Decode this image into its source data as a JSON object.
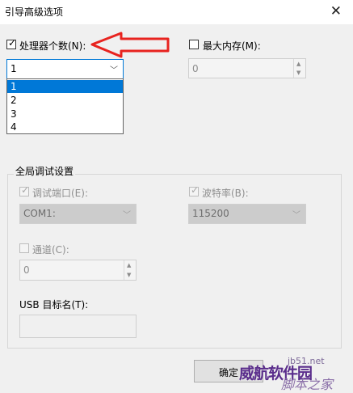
{
  "window": {
    "title": "引导高级选项"
  },
  "processors": {
    "label": "处理器个数(N):",
    "checked": true,
    "selected": "1",
    "options": [
      "1",
      "2",
      "3",
      "4"
    ]
  },
  "max_memory": {
    "label": "最大内存(M):",
    "checked": false,
    "value": "0"
  },
  "debug_group": {
    "title": "全局调试设置",
    "debug_port": {
      "label": "调试端口(E):",
      "value": "COM1:"
    },
    "baud_rate": {
      "label": "波特率(B):",
      "value": "115200"
    },
    "channel": {
      "label": "通道(C):",
      "value": "0"
    },
    "usb_target": {
      "label": "USB 目标名(T):",
      "value": ""
    }
  },
  "buttons": {
    "ok": "确定"
  },
  "watermark": {
    "line1": "威航软件园",
    "line2": "脚本之家",
    "line3": "jb51.net"
  },
  "colors": {
    "selection": "#0078d7",
    "annotation_arrow": "#e8231f",
    "watermark": "#5a2d8c"
  }
}
